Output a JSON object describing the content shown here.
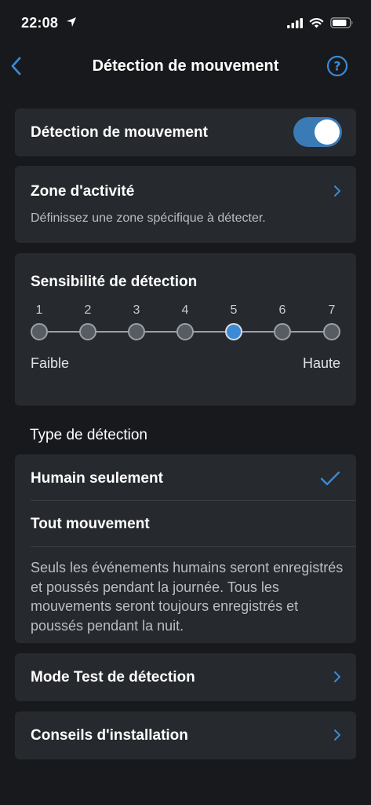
{
  "status_bar": {
    "time": "22:08"
  },
  "nav": {
    "title": "Détection de mouvement",
    "back_icon": "chevron-left-icon",
    "help_icon": "question-circle-icon"
  },
  "motion_detection": {
    "label": "Détection de mouvement",
    "enabled": true
  },
  "activity_zone": {
    "label": "Zone d'activité",
    "description": "Définissez une zone spécifique à détecter."
  },
  "sensitivity": {
    "label": "Sensibilité de détection",
    "levels": [
      "1",
      "2",
      "3",
      "4",
      "5",
      "6",
      "7"
    ],
    "selected": 5,
    "low_label": "Faible",
    "high_label": "Haute"
  },
  "detection_type": {
    "section_label": "Type de détection",
    "options": [
      {
        "label": "Humain seulement",
        "selected": true
      },
      {
        "label": "Tout mouvement",
        "selected": false
      }
    ],
    "description": "Seuls les événements humains seront enregistrés et poussés pendant la journée. Tous les mouvements seront toujours enregistrés et poussés pendant la nuit."
  },
  "test_mode": {
    "label": "Mode Test de détection"
  },
  "installation_tips": {
    "label": "Conseils d'installation"
  },
  "colors": {
    "background": "#17191c",
    "card": "#26292d",
    "accent": "#3a7ab5",
    "secondary_text": "#b9bec6"
  }
}
